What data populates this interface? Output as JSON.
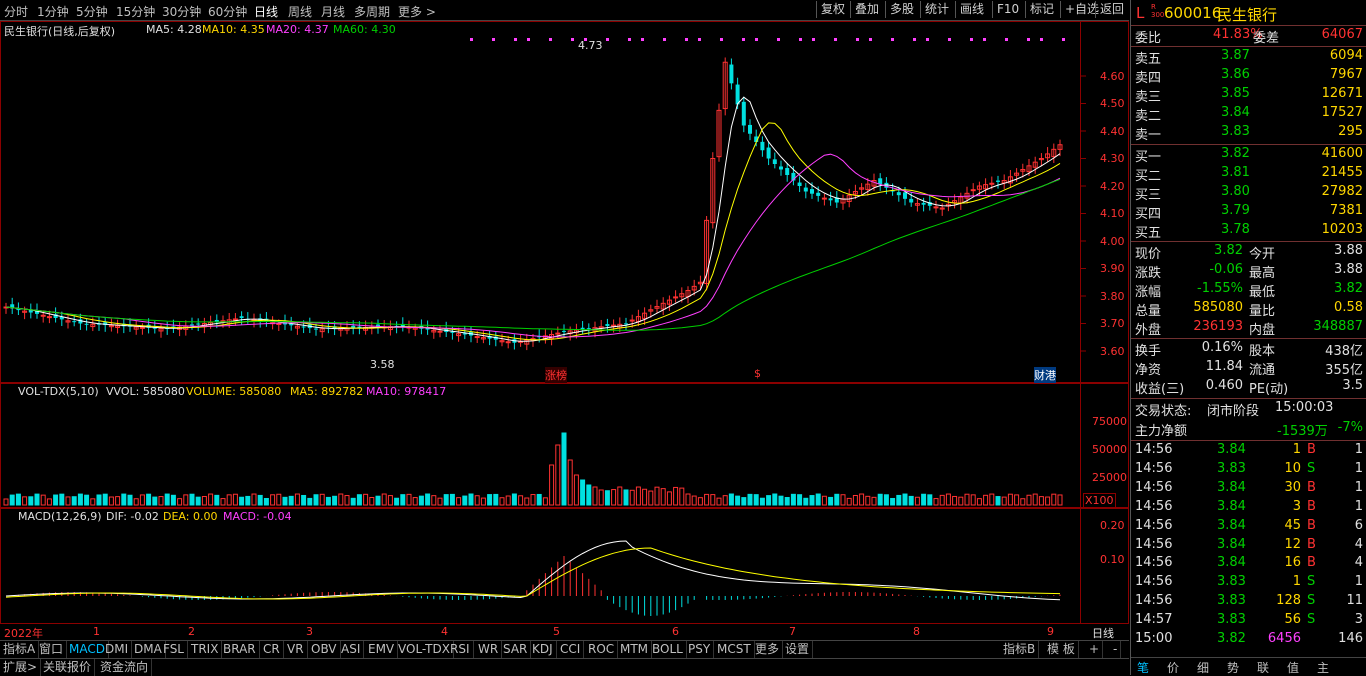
{
  "topbar": {
    "tabs": [
      "分时",
      "1分钟",
      "5分钟",
      "15分钟",
      "30分钟",
      "60分钟",
      "日线",
      "周线",
      "月线",
      "多周期",
      "更多 >"
    ],
    "active_tab": "日线",
    "right_buttons": [
      "复权",
      "叠加",
      "多股",
      "统计",
      "画线",
      "F10",
      "标记",
      "+自选",
      "返回"
    ]
  },
  "main_chart": {
    "header_title": "民生银行(日线,后复权)",
    "ma5": "MA5: 4.28",
    "ma10": "MA10: 4.35",
    "ma20": "MA20: 4.37",
    "ma60": "MA60: 4.30",
    "y_ticks": [
      "4.60",
      "4.50",
      "4.40",
      "4.30",
      "4.20",
      "4.10",
      "4.00",
      "3.90",
      "3.80",
      "3.70",
      "3.60"
    ],
    "high_label": "4.73",
    "low_label": "3.58",
    "event_labels": [
      "涨榜",
      "$",
      "财港"
    ],
    "colors": {
      "up": "#ff3232",
      "down": "#00e0e0",
      "ma5": "#ffffff",
      "ma10": "#ffff00",
      "ma20": "#ff40ff",
      "ma60": "#00d000"
    }
  },
  "volume_chart": {
    "indicator": "VOL-TDX(5,10)",
    "vvol": "VVOL: 585080",
    "volume": "VOLUME: 585080",
    "ma5": "MA5: 892782",
    "ma10": "MA10: 978417",
    "y_ticks": [
      "75000",
      "50000",
      "25000"
    ],
    "unit": "X100"
  },
  "macd_chart": {
    "indicator": "MACD(12,26,9)",
    "dif": "DIF: -0.02",
    "dea": "DEA: 0.00",
    "macd": "MACD: -0.04",
    "y_ticks": [
      "0.20",
      "0.10"
    ]
  },
  "x_axis": {
    "labels": [
      "2022年",
      "1",
      "2",
      "3",
      "4",
      "5",
      "6",
      "7",
      "8",
      "9"
    ],
    "period_label": "日线"
  },
  "bottom_tabs": {
    "row1": [
      "指标A",
      "窗口",
      "MACD",
      "DMI",
      "DMA",
      "FSL",
      "TRIX",
      "BRAR",
      "CR",
      "VR",
      "OBV",
      "ASI",
      "EMV",
      "VOL-TDX",
      "RSI",
      "WR",
      "SAR",
      "KDJ",
      "CCI",
      "ROC",
      "MTM",
      "BOLL",
      "PSY",
      "MCST",
      "更多",
      "设置"
    ],
    "active": "MACD",
    "row1_right": [
      "指标B",
      "模 板",
      "+",
      "-"
    ],
    "row2": [
      "扩展>",
      "关联报价",
      "资金流向"
    ]
  },
  "quote_panel": {
    "prefix": "L",
    "badge": "R\n300",
    "code": "600016",
    "name": "民生银行",
    "weibi_label": "委比",
    "weibi_value": "41.83%",
    "weicha_label": "委差",
    "weicha_value": "64067",
    "asks": [
      {
        "label": "卖五",
        "price": "3.87",
        "vol": "6094"
      },
      {
        "label": "卖四",
        "price": "3.86",
        "vol": "7967"
      },
      {
        "label": "卖三",
        "price": "3.85",
        "vol": "12671"
      },
      {
        "label": "卖二",
        "price": "3.84",
        "vol": "17527"
      },
      {
        "label": "卖一",
        "price": "3.83",
        "vol": "295"
      }
    ],
    "bids": [
      {
        "label": "买一",
        "price": "3.82",
        "vol": "41600"
      },
      {
        "label": "买二",
        "price": "3.81",
        "vol": "21455"
      },
      {
        "label": "买三",
        "price": "3.80",
        "vol": "27982"
      },
      {
        "label": "买四",
        "price": "3.79",
        "vol": "7381"
      },
      {
        "label": "买五",
        "price": "3.78",
        "vol": "10203"
      }
    ],
    "stats": [
      {
        "l1": "现价",
        "v1": "3.82",
        "l2": "今开",
        "v2": "3.88"
      },
      {
        "l1": "涨跌",
        "v1": "-0.06",
        "l2": "最高",
        "v2": "3.88"
      },
      {
        "l1": "涨幅",
        "v1": "-1.55%",
        "l2": "最低",
        "v2": "3.82"
      },
      {
        "l1": "总量",
        "v1": "585080",
        "l2": "量比",
        "v2": "0.58"
      },
      {
        "l1": "外盘",
        "v1": "236193",
        "l2": "内盘",
        "v2": "348887"
      }
    ],
    "fund": [
      {
        "l1": "换手",
        "v1": "0.16%",
        "l2": "股本",
        "v2": "438亿"
      },
      {
        "l1": "净资",
        "v1": "11.84",
        "l2": "流通",
        "v2": "355亿"
      },
      {
        "l1": "收益(三)",
        "v1": "0.460",
        "l2": "PE(动)",
        "v2": "3.5"
      }
    ],
    "trade_status_label": "交易状态:",
    "trade_status_value": "闭市阶段",
    "trade_time": "15:00:03",
    "main_flow_label": "主力净额",
    "main_flow_value": "-1539万",
    "main_flow_pct": "-7%",
    "ticks": [
      {
        "time": "14:56",
        "price": "3.84",
        "vol": "1",
        "side": "B",
        "n": "1"
      },
      {
        "time": "14:56",
        "price": "3.83",
        "vol": "10",
        "side": "S",
        "n": "1"
      },
      {
        "time": "14:56",
        "price": "3.84",
        "vol": "30",
        "side": "B",
        "n": "1"
      },
      {
        "time": "14:56",
        "price": "3.84",
        "vol": "3",
        "side": "B",
        "n": "1"
      },
      {
        "time": "14:56",
        "price": "3.84",
        "vol": "45",
        "side": "B",
        "n": "6"
      },
      {
        "time": "14:56",
        "price": "3.84",
        "vol": "12",
        "side": "B",
        "n": "4"
      },
      {
        "time": "14:56",
        "price": "3.84",
        "vol": "16",
        "side": "B",
        "n": "4"
      },
      {
        "time": "14:56",
        "price": "3.83",
        "vol": "1",
        "side": "S",
        "n": "1"
      },
      {
        "time": "14:56",
        "price": "3.83",
        "vol": "128",
        "side": "S",
        "n": "11"
      },
      {
        "time": "14:57",
        "price": "3.83",
        "vol": "56",
        "side": "S",
        "n": "3"
      },
      {
        "time": "15:00",
        "price": "3.82",
        "vol": "6456",
        "side": "",
        "n": "146"
      }
    ],
    "bottom_tabs": [
      "笔",
      "价",
      "细",
      "势",
      "联",
      "值",
      "主"
    ]
  }
}
